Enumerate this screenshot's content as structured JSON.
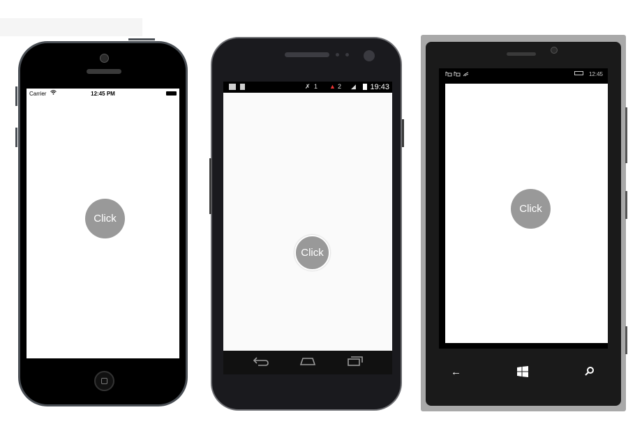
{
  "ios": {
    "status": {
      "carrier": "Carrier",
      "time": "12:45 PM"
    },
    "button_label": "Click"
  },
  "android": {
    "status": {
      "time": "19:43",
      "count1": "1",
      "count2": "2"
    },
    "button_label": "Click"
  },
  "windows": {
    "status": {
      "time": "12:45"
    },
    "button_label": "Click"
  },
  "colors": {
    "button": "#999999",
    "screen": "#ffffff"
  }
}
